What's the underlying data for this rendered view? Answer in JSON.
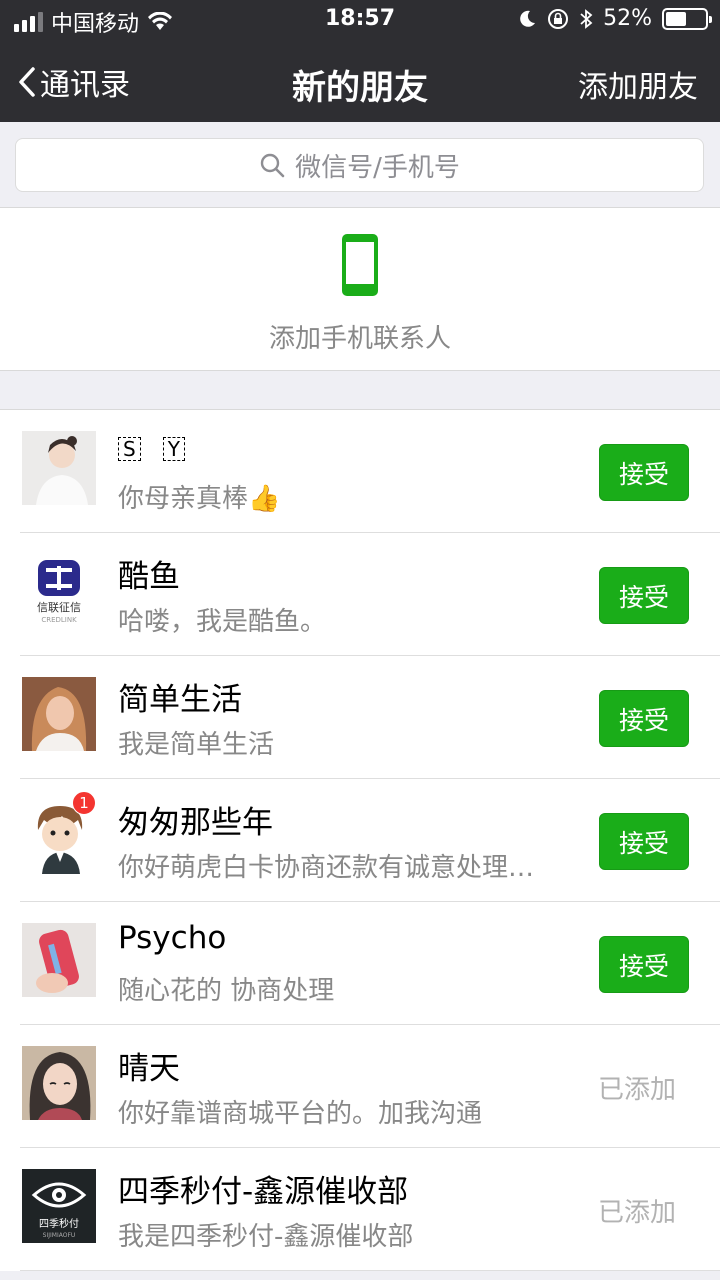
{
  "status_bar": {
    "carrier": "中国移动",
    "time": "18:57",
    "battery": "52%",
    "battery_level": 0.52
  },
  "nav": {
    "back_label": "通讯录",
    "title": "新的朋友",
    "add_label": "添加朋友"
  },
  "search": {
    "placeholder": "微信号/手机号"
  },
  "add_phone": {
    "label": "添加手机联系人"
  },
  "colors": {
    "accent": "#1aad19",
    "nav_bg": "#2e2e32",
    "badge": "#f43530"
  },
  "requests": [
    {
      "name_chars": [
        "S",
        "Y"
      ],
      "message": "你母亲真棒👍",
      "action": "接受",
      "status": "pending"
    },
    {
      "name": "酷鱼",
      "message": "哈喽，我是酷鱼。",
      "action": "接受",
      "status": "pending",
      "avatar_text": "信联征信",
      "avatar_subtext": "CREDLINK"
    },
    {
      "name": "简单生活",
      "message": "我是简单生活",
      "action": "接受",
      "status": "pending"
    },
    {
      "name": "匆匆那些年",
      "message": "你好萌虎白卡协商还款有诚意处理…",
      "action": "接受",
      "status": "pending",
      "badge": "1"
    },
    {
      "name": "Psycho",
      "message": "随心花的 协商处理",
      "action": "接受",
      "status": "pending"
    },
    {
      "name": "晴天",
      "message": "你好靠谱商城平台的。加我沟通",
      "action": "已添加",
      "status": "added"
    },
    {
      "name": "四季秒付-鑫源催收部",
      "message": "我是四季秒付-鑫源催收部",
      "action": "已添加",
      "status": "added",
      "avatar_text": "四季秒付",
      "avatar_subtext": "SIJIMIAOFU"
    }
  ]
}
